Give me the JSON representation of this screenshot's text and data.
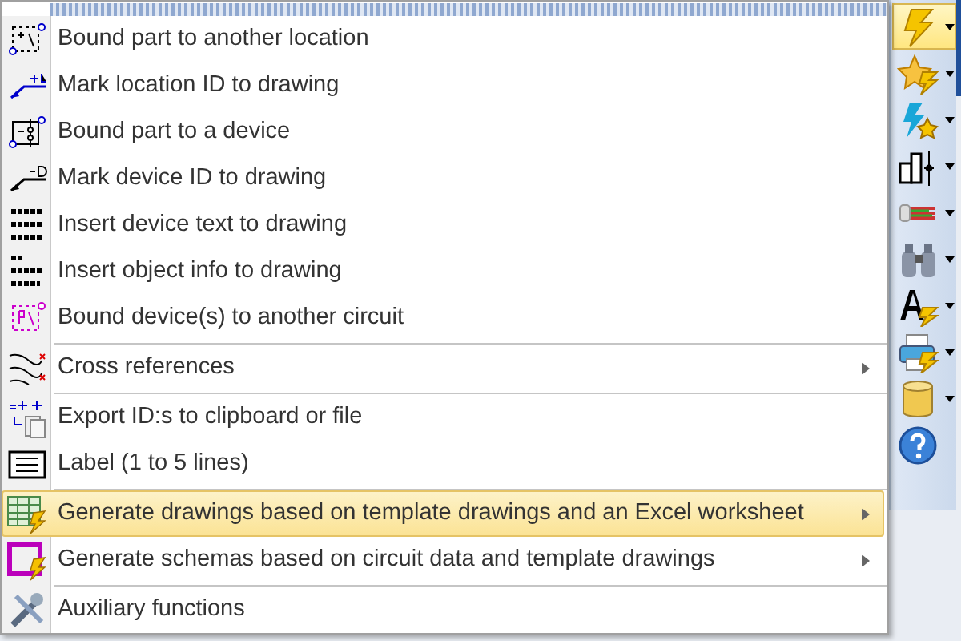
{
  "menu": {
    "groups": [
      [
        {
          "kind": "bound-location",
          "label": "Bound part to another location",
          "submenu": false,
          "selected": false
        },
        {
          "kind": "mark-location",
          "label": "Mark location ID to drawing",
          "submenu": false,
          "selected": false
        },
        {
          "kind": "bound-device",
          "label": "Bound part to a device",
          "submenu": false,
          "selected": false
        },
        {
          "kind": "mark-device",
          "label": "Mark device ID to drawing",
          "submenu": false,
          "selected": false
        },
        {
          "kind": "txt3",
          "label": "Insert device text to drawing",
          "submenu": false,
          "selected": false
        },
        {
          "kind": "objinfo",
          "label": "Insert object info to drawing",
          "submenu": false,
          "selected": false
        },
        {
          "kind": "bound-circuit",
          "label": "Bound device(s) to another circuit",
          "submenu": false,
          "selected": false
        }
      ],
      [
        {
          "kind": "crossref",
          "label": "Cross references",
          "submenu": true,
          "selected": false
        }
      ],
      [
        {
          "kind": "export",
          "label": "Export ID:s to clipboard or file",
          "submenu": false,
          "selected": false
        },
        {
          "kind": "label",
          "label": "Label (1 to 5 lines)",
          "submenu": false,
          "selected": false
        }
      ],
      [
        {
          "kind": "excel",
          "label": "Generate drawings based on template drawings and an Excel worksheet",
          "submenu": true,
          "selected": true
        },
        {
          "kind": "schema",
          "label": "Generate schemas based on circuit data and template drawings",
          "submenu": true,
          "selected": false
        }
      ],
      [
        {
          "kind": "tools",
          "label": "Auxiliary functions",
          "submenu": false,
          "selected": false
        }
      ]
    ]
  },
  "toolbar": {
    "buttons": [
      {
        "kind": "lightning",
        "dropdown": true,
        "selected": true
      },
      {
        "kind": "star-lightning",
        "dropdown": true,
        "selected": false
      },
      {
        "kind": "lightning-star",
        "dropdown": true,
        "selected": false
      },
      {
        "kind": "layout",
        "dropdown": true,
        "selected": false
      },
      {
        "kind": "cables",
        "dropdown": true,
        "selected": false
      },
      {
        "kind": "binoculars",
        "dropdown": true,
        "selected": false
      },
      {
        "kind": "font",
        "dropdown": true,
        "selected": false
      },
      {
        "kind": "printer",
        "dropdown": true,
        "selected": false
      },
      {
        "kind": "database",
        "dropdown": true,
        "selected": false
      },
      {
        "kind": "help",
        "dropdown": false,
        "selected": false
      }
    ]
  }
}
